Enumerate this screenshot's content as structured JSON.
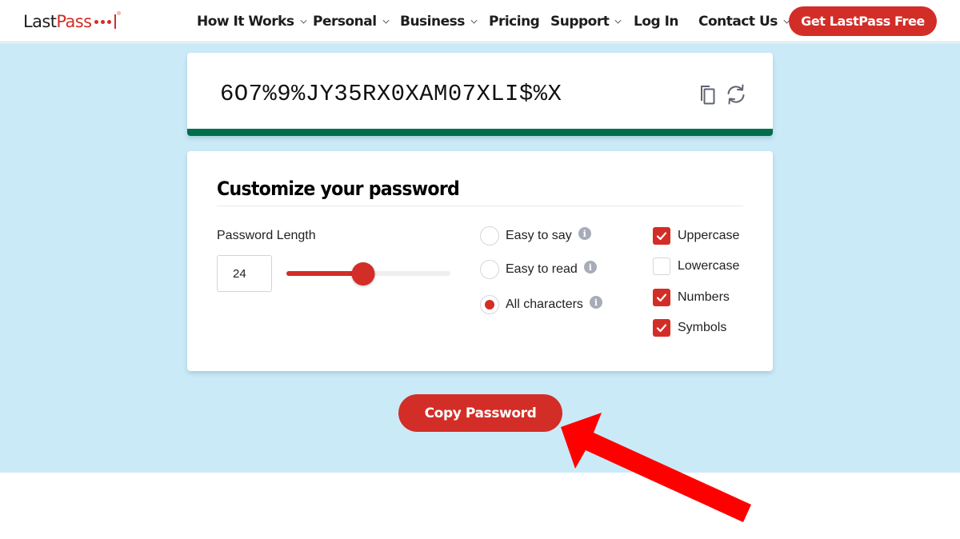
{
  "header": {
    "logo": {
      "part1": "Last",
      "part2": "Pass",
      "reg": "®"
    },
    "nav": [
      {
        "label": "How It Works",
        "has_dropdown": true
      },
      {
        "label": "Personal",
        "has_dropdown": true
      },
      {
        "label": "Business",
        "has_dropdown": true
      },
      {
        "label": "Pricing",
        "has_dropdown": false
      },
      {
        "label": "Support",
        "has_dropdown": true
      },
      {
        "label": "Log In",
        "has_dropdown": false
      },
      {
        "label": "Contact Us",
        "has_dropdown": true
      }
    ],
    "cta_label": "Get LastPass Free"
  },
  "generator": {
    "password": "6O7%9%JY35RX0XAM07XLI$%X",
    "copy_icon": "copy-icon",
    "refresh_icon": "refresh-icon",
    "strength_color": "#006e4c"
  },
  "customize": {
    "title": "Customize your password",
    "length_label": "Password Length",
    "length_value": "24",
    "slider": {
      "min": 1,
      "max": 50,
      "value": 24
    },
    "modes": [
      {
        "label": "Easy to say",
        "selected": false
      },
      {
        "label": "Easy to read",
        "selected": false
      },
      {
        "label": "All characters",
        "selected": true
      }
    ],
    "info_glyph": "i",
    "charsets": [
      {
        "label": "Uppercase",
        "checked": true
      },
      {
        "label": "Lowercase",
        "checked": false
      },
      {
        "label": "Numbers",
        "checked": true
      },
      {
        "label": "Symbols",
        "checked": true
      }
    ]
  },
  "copy_button_label": "Copy Password",
  "colors": {
    "brand_red": "#d32d27",
    "band_blue": "#cbeaf8",
    "annotation_red": "#ff0000"
  }
}
